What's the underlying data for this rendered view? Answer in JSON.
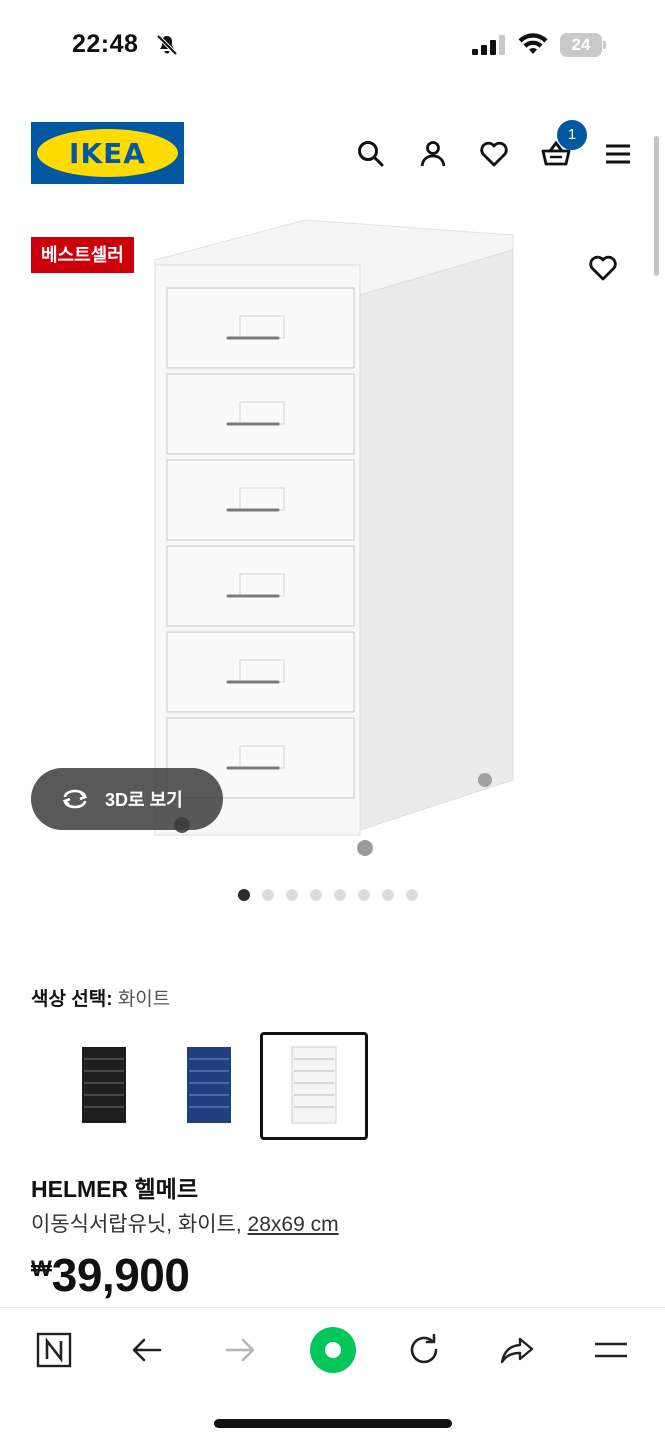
{
  "status_bar": {
    "time": "22:48",
    "battery": "24"
  },
  "header": {
    "logo": "IKEA",
    "cart_count": "1"
  },
  "product": {
    "badge": "베스트셀러",
    "view_3d_label": "3D로 보기",
    "image_count": 8,
    "active_image": 1,
    "color_label": "색상 선택:",
    "color_value": "화이트",
    "swatches": [
      "black",
      "blue",
      "white"
    ],
    "selected_swatch": "white",
    "name": "HELMER 헬메르",
    "description": "이동식서랍유닛, 화이트,",
    "size": "28x69 cm",
    "price_currency": "₩",
    "price": "39,900"
  },
  "browser_bar": {
    "items": [
      "naver-n-icon",
      "back-arrow-icon",
      "forward-arrow-icon",
      "green-assistant-icon",
      "reload-icon",
      "share-icon",
      "menu-icon"
    ]
  },
  "colors": {
    "ikea_blue": "#0058a3",
    "ikea_yellow": "#ffdb00",
    "badge_red": "#cc0008",
    "assistant_green": "#03c75a"
  }
}
